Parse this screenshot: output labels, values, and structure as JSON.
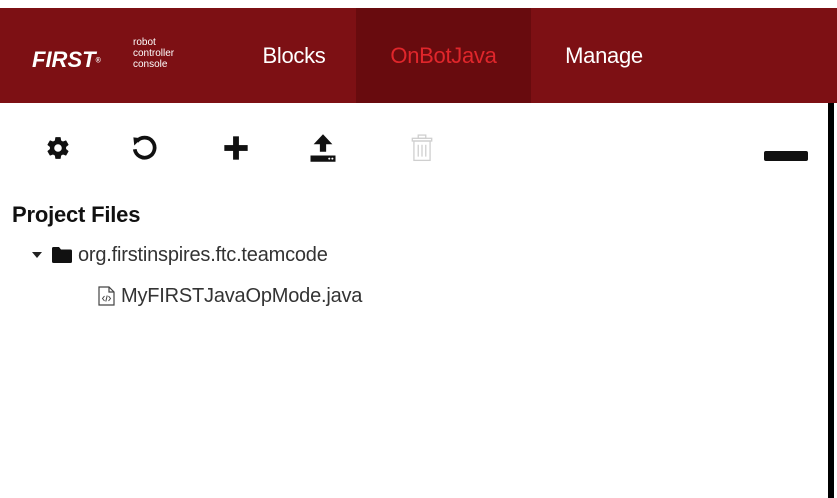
{
  "brand": {
    "first": "FIRST",
    "tm": "®",
    "subtitle_line1": "robot",
    "subtitle_line2": "controller",
    "subtitle_line3": "console"
  },
  "nav": {
    "items": [
      {
        "label": "Blocks",
        "active": false
      },
      {
        "label": "OnBotJava",
        "active": true
      },
      {
        "label": "Manage",
        "active": false
      }
    ]
  },
  "toolbar": {
    "icons": [
      "gear-icon",
      "refresh-icon",
      "plus-icon",
      "upload-icon",
      "trash-icon",
      "minus-icon"
    ],
    "trash_disabled": true
  },
  "project": {
    "title": "Project Files",
    "folder": "org.firstinspires.ftc.teamcode",
    "folder_expanded": true,
    "files": [
      "MyFIRSTJavaOpMode.java"
    ]
  },
  "colors": {
    "navbar_bg": "#7d1014",
    "active_tab_bg": "#680b0e",
    "active_tab_text": "#e0262b",
    "nav_text": "#ffffff"
  }
}
